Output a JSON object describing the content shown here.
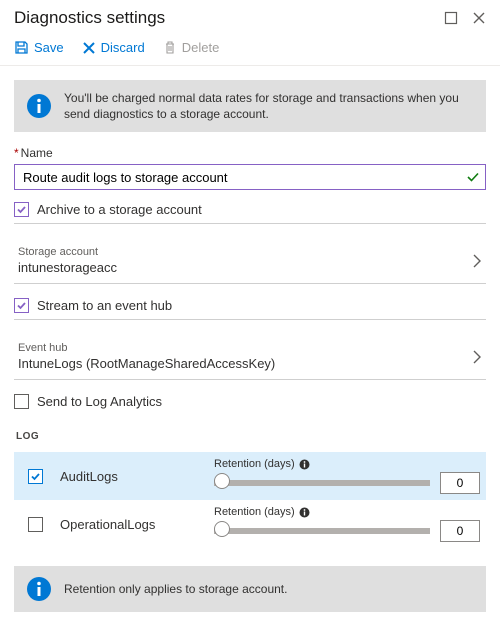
{
  "header": {
    "title": "Diagnostics settings"
  },
  "toolbar": {
    "save_label": "Save",
    "discard_label": "Discard",
    "delete_label": "Delete"
  },
  "info": {
    "storage_warning": "You'll be charged normal data rates for storage and transactions when you send diagnostics to a storage account.",
    "retention_note": "Retention only applies to storage account."
  },
  "name": {
    "label": "Name",
    "value": "Route audit logs to storage account"
  },
  "archive": {
    "label": "Archive to a storage account",
    "checked": true,
    "storage_label": "Storage account",
    "storage_value": "intunestorageacc"
  },
  "stream": {
    "label": "Stream to an event hub",
    "checked": true,
    "hub_label": "Event hub",
    "hub_value": "IntuneLogs (RootManageSharedAccessKey)"
  },
  "log_analytics": {
    "label": "Send to Log Analytics",
    "checked": false
  },
  "logs": {
    "heading": "LOG",
    "retention_label": "Retention (days)",
    "rows": [
      {
        "name": "AuditLogs",
        "checked": true,
        "retention": "0",
        "selected": true
      },
      {
        "name": "OperationalLogs",
        "checked": false,
        "retention": "0",
        "selected": false
      }
    ]
  }
}
